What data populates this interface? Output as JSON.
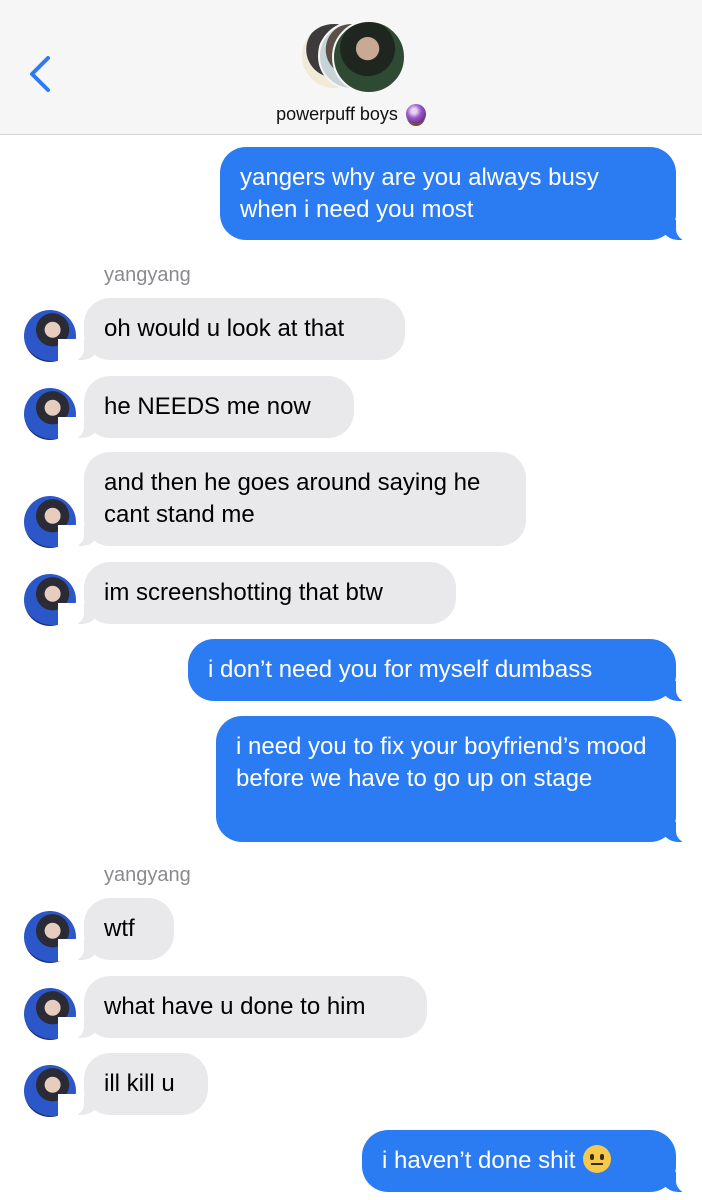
{
  "header": {
    "group_name": "powerpuff boys",
    "group_emoji": "crystal-ball-emoji",
    "back_icon": "chevron-left-icon"
  },
  "colors": {
    "sent_bubble": "#2b7bf2",
    "received_bubble": "#e9e9eb",
    "header_bg": "#f6f6f6",
    "back_icon": "#2b7bf2"
  },
  "messages": [
    {
      "type": "sent",
      "text": "yangers why are you always busy when i need you most"
    },
    {
      "type": "sender_label",
      "text": "yangyang"
    },
    {
      "type": "received",
      "text": "oh would u look at that"
    },
    {
      "type": "received",
      "text": "he NEEDS me now"
    },
    {
      "type": "received",
      "text": "and then he goes around saying he cant stand me"
    },
    {
      "type": "received",
      "text": "im screenshotting that btw"
    },
    {
      "type": "sent",
      "text": "i don’t need you for myself dumbass"
    },
    {
      "type": "sent",
      "text": "i need you to fix your boyfriend’s mood before we have to go up on stage"
    },
    {
      "type": "sender_label",
      "text": "yangyang"
    },
    {
      "type": "received",
      "text": "wtf"
    },
    {
      "type": "received",
      "text": "what have u done to him"
    },
    {
      "type": "received",
      "text": "ill kill u"
    },
    {
      "type": "sent",
      "text": "i haven’t done shit",
      "emoji": "neutral-face-emoji"
    }
  ]
}
